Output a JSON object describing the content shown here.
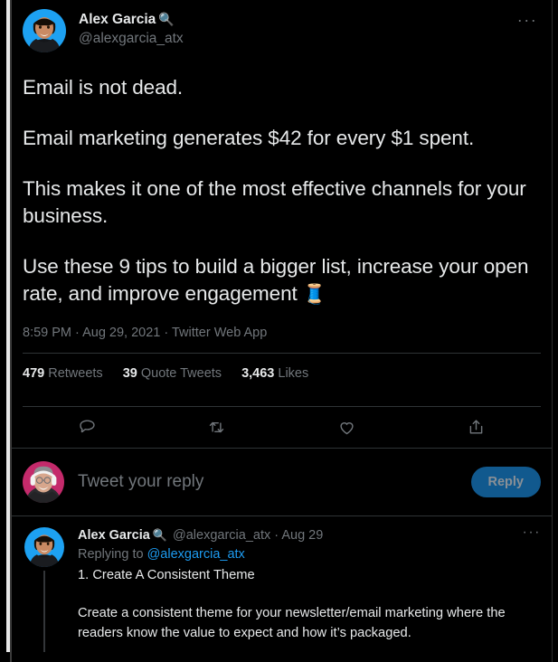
{
  "theme": {
    "background": "#000000",
    "text_primary": "#e7e9ea",
    "text_secondary": "#71767b",
    "link": "#1d9bf0",
    "divider": "#2f3336",
    "reply_button_bg": "#11598e",
    "reply_button_text": "#8a9096",
    "avatar_main_bg": "#1da1f2",
    "avatar_composer_bg": "#c42a6b",
    "thread_line": "#333639"
  },
  "main_tweet": {
    "author": {
      "display_name": "Alex Garcia",
      "name_emoji": "🔍",
      "handle": "@alexgarcia_atx",
      "avatar_name": "alex-garcia-avatar"
    },
    "more_menu_label": "···",
    "body": [
      "Email is not dead.",
      "Email marketing generates $42 for every $1 spent.",
      "This makes it one of the most effective channels for your business.",
      "Use these 9 tips to build a bigger list, increase your open rate, and improve engagement "
    ],
    "body_trailing_emoji": "🧵",
    "meta": {
      "time": "8:59 PM",
      "separator": " · ",
      "date": "Aug 29, 2021",
      "source": "Twitter Web App",
      "full": "8:59 PM · Aug 29, 2021 · Twitter Web App"
    },
    "stats": [
      {
        "count": "479",
        "label": "Retweets"
      },
      {
        "count": "39",
        "label": "Quote Tweets"
      },
      {
        "count": "3,463",
        "label": "Likes"
      }
    ],
    "actions": [
      {
        "name": "reply-action",
        "icon": "comment-icon"
      },
      {
        "name": "retweet-action",
        "icon": "retweet-icon"
      },
      {
        "name": "like-action",
        "icon": "heart-icon"
      },
      {
        "name": "share-action",
        "icon": "share-icon"
      }
    ]
  },
  "composer": {
    "avatar_name": "current-user-avatar",
    "placeholder": "Tweet your reply",
    "reply_label": "Reply"
  },
  "reply_tweet": {
    "author": {
      "display_name": "Alex Garcia",
      "name_emoji": "🔍",
      "handle": "@alexgarcia_atx",
      "date": "Aug 29",
      "meta_suffix": " @alexgarcia_atx · Aug 29",
      "avatar_name": "alex-garcia-avatar"
    },
    "more_menu_label": "···",
    "replying_to_prefix": "Replying to ",
    "replying_to_mention": "@alexgarcia_atx",
    "title": "1. Create A Consistent Theme",
    "text": "Create a consistent theme for your newsletter/email marketing where the readers know the value to expect and how it’s packaged."
  }
}
